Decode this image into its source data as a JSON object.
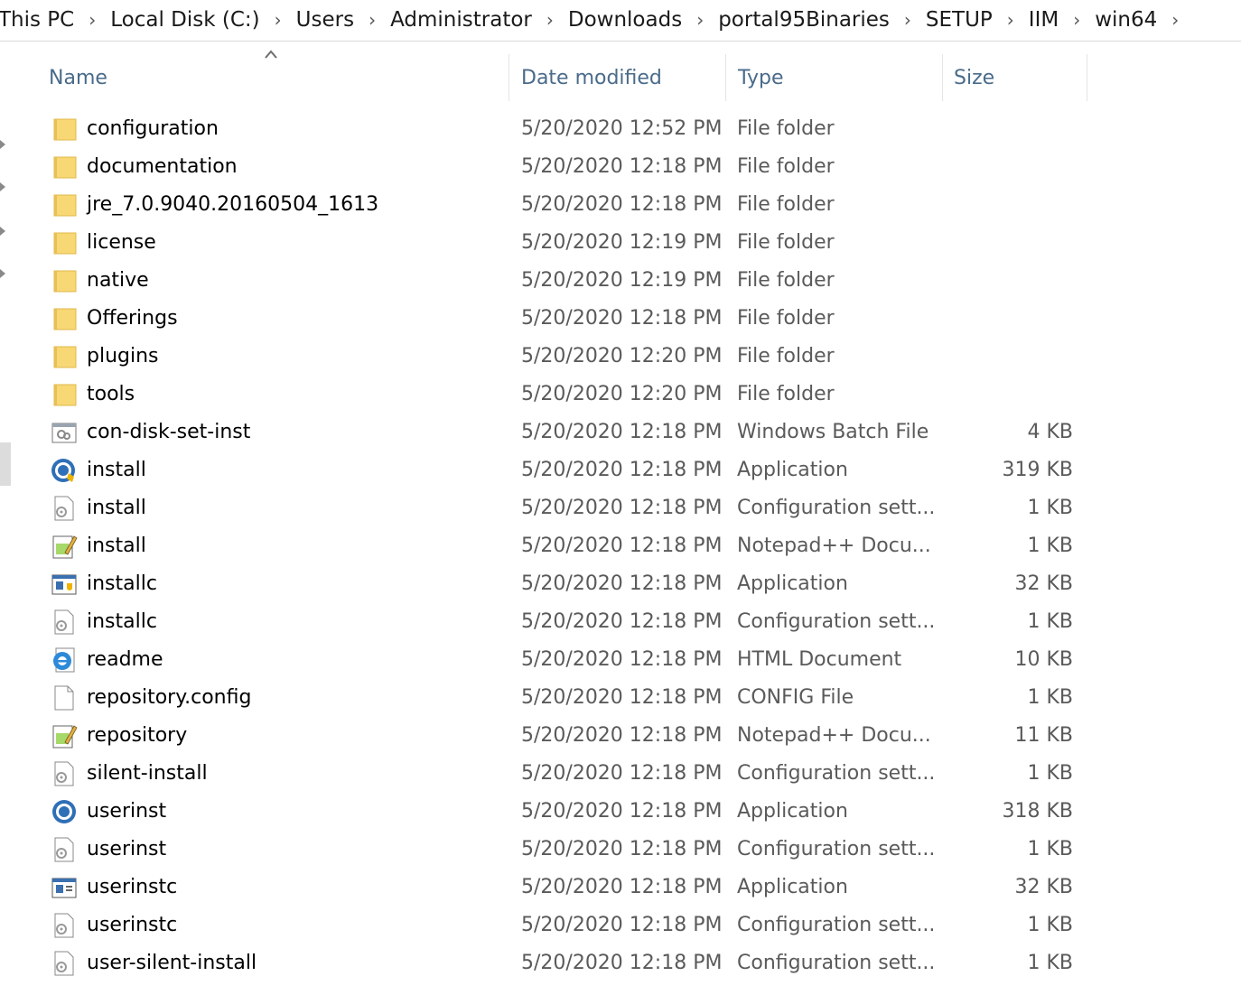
{
  "breadcrumb": [
    "This PC",
    "Local Disk (C:)",
    "Users",
    "Administrator",
    "Downloads",
    "portal95Binaries",
    "SETUP",
    "IIM",
    "win64"
  ],
  "columns": {
    "name": "Name",
    "date": "Date modified",
    "type": "Type",
    "size": "Size"
  },
  "files": [
    {
      "name": "configuration",
      "date": "5/20/2020 12:52 PM",
      "type": "File folder",
      "size": "",
      "icon": "folder-icon"
    },
    {
      "name": "documentation",
      "date": "5/20/2020 12:18 PM",
      "type": "File folder",
      "size": "",
      "icon": "folder-icon"
    },
    {
      "name": "jre_7.0.9040.20160504_1613",
      "date": "5/20/2020 12:18 PM",
      "type": "File folder",
      "size": "",
      "icon": "folder-icon"
    },
    {
      "name": "license",
      "date": "5/20/2020 12:19 PM",
      "type": "File folder",
      "size": "",
      "icon": "folder-icon"
    },
    {
      "name": "native",
      "date": "5/20/2020 12:19 PM",
      "type": "File folder",
      "size": "",
      "icon": "folder-icon"
    },
    {
      "name": "Offerings",
      "date": "5/20/2020 12:18 PM",
      "type": "File folder",
      "size": "",
      "icon": "folder-icon"
    },
    {
      "name": "plugins",
      "date": "5/20/2020 12:20 PM",
      "type": "File folder",
      "size": "",
      "icon": "folder-icon"
    },
    {
      "name": "tools",
      "date": "5/20/2020 12:20 PM",
      "type": "File folder",
      "size": "",
      "icon": "folder-icon"
    },
    {
      "name": "con-disk-set-inst",
      "date": "5/20/2020 12:18 PM",
      "type": "Windows Batch File",
      "size": "4 KB",
      "icon": "batch-file-icon"
    },
    {
      "name": "install",
      "date": "5/20/2020 12:18 PM",
      "type": "Application",
      "size": "319 KB",
      "icon": "installer-app-icon"
    },
    {
      "name": "install",
      "date": "5/20/2020 12:18 PM",
      "type": "Configuration sett...",
      "size": "1 KB",
      "icon": "config-settings-icon"
    },
    {
      "name": "install",
      "date": "5/20/2020 12:18 PM",
      "type": "Notepad++ Docu...",
      "size": "1 KB",
      "icon": "notepad-document-icon"
    },
    {
      "name": "installc",
      "date": "5/20/2020 12:18 PM",
      "type": "Application",
      "size": "32 KB",
      "icon": "console-app-shield-icon"
    },
    {
      "name": "installc",
      "date": "5/20/2020 12:18 PM",
      "type": "Configuration sett...",
      "size": "1 KB",
      "icon": "config-settings-icon"
    },
    {
      "name": "readme",
      "date": "5/20/2020 12:18 PM",
      "type": "HTML Document",
      "size": "10 KB",
      "icon": "html-document-icon"
    },
    {
      "name": "repository.config",
      "date": "5/20/2020 12:18 PM",
      "type": "CONFIG File",
      "size": "1 KB",
      "icon": "blank-file-icon"
    },
    {
      "name": "repository",
      "date": "5/20/2020 12:18 PM",
      "type": "Notepad++ Docu...",
      "size": "11 KB",
      "icon": "notepad-document-icon"
    },
    {
      "name": "silent-install",
      "date": "5/20/2020 12:18 PM",
      "type": "Configuration sett...",
      "size": "1 KB",
      "icon": "config-settings-icon"
    },
    {
      "name": "userinst",
      "date": "5/20/2020 12:18 PM",
      "type": "Application",
      "size": "318 KB",
      "icon": "user-installer-app-icon"
    },
    {
      "name": "userinst",
      "date": "5/20/2020 12:18 PM",
      "type": "Configuration sett...",
      "size": "1 KB",
      "icon": "config-settings-icon"
    },
    {
      "name": "userinstc",
      "date": "5/20/2020 12:18 PM",
      "type": "Application",
      "size": "32 KB",
      "icon": "console-app-icon"
    },
    {
      "name": "userinstc",
      "date": "5/20/2020 12:18 PM",
      "type": "Configuration sett...",
      "size": "1 KB",
      "icon": "config-settings-icon"
    },
    {
      "name": "user-silent-install",
      "date": "5/20/2020 12:18 PM",
      "type": "Configuration sett...",
      "size": "1 KB",
      "icon": "config-settings-icon"
    }
  ]
}
